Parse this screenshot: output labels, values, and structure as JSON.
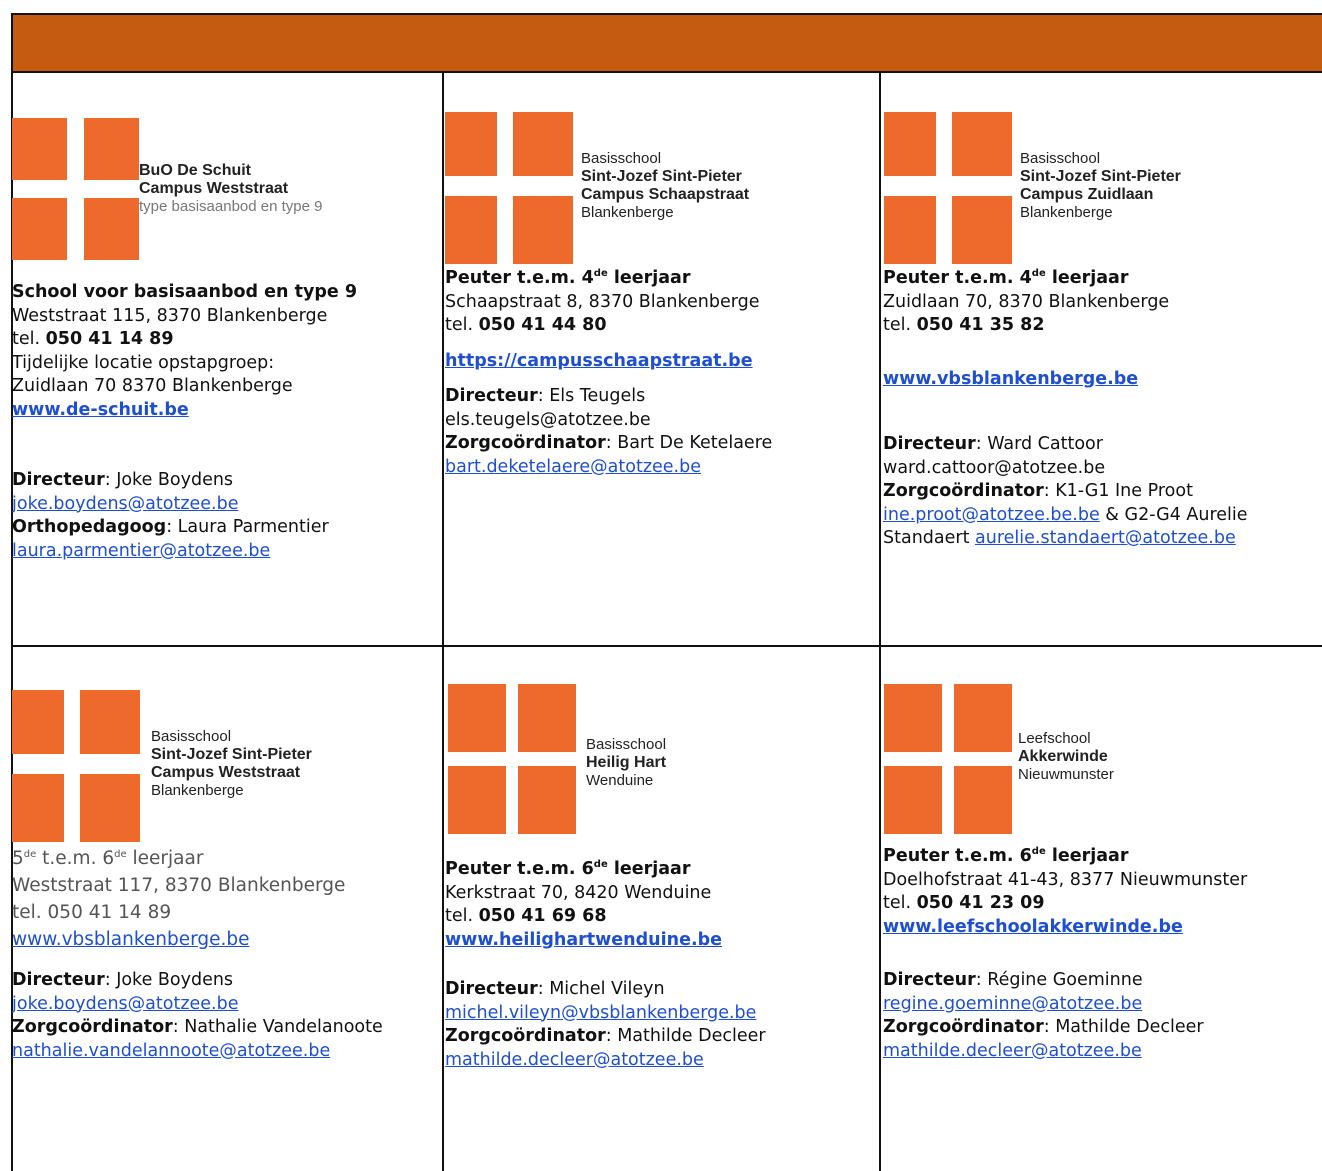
{
  "cells": [
    {
      "logo": {
        "lines": [
          "BuO De Schuit",
          "Campus Weststraat",
          "type basisaanbod en type 9"
        ]
      },
      "heading": "School voor basisaanbod en type 9",
      "address": "Weststraat 115, 8370 Blankenberge",
      "tel_prefix": "tel. ",
      "tel": "050 41 14 89",
      "extra1": "Tijdelijke locatie opstapgroep:",
      "extra2": "Zuidlaan 70 8370 Blankenberge",
      "website": "www.de-schuit.be",
      "role1": "Directeur",
      "person1": ": Joke Boydens",
      "email1": "joke.boydens@atotzee.be",
      "role2": "Orthopedagoog",
      "person2": ": Laura Parmentier",
      "email2": "laura.parmentier@atotzee.be"
    },
    {
      "logo": {
        "lines": [
          "Basisschool",
          "Sint-Jozef Sint-Pieter",
          "Campus Schaapstraat",
          "Blankenberge"
        ]
      },
      "heading_a": "Peuter t.e.m. 4",
      "heading_sup": "de",
      "heading_b": " leerjaar",
      "address": "Schaapstraat 8, 8370 Blankenberge",
      "tel_prefix": "tel. ",
      "tel": "050 41 44 80",
      "website": "https://campusschaapstraat.be",
      "role1": "Directeur",
      "person1": ": Els Teugels",
      "email1": "els.teugels@atotzee.be",
      "role2": "Zorgcoördinator",
      "person2": ": Bart De Ketelaere",
      "email2": "bart.deketelaere@atotzee.be"
    },
    {
      "logo": {
        "lines": [
          "Basisschool",
          "Sint-Jozef Sint-Pieter",
          "Campus Zuidlaan",
          "Blankenberge"
        ]
      },
      "heading_a": "Peuter t.e.m. 4",
      "heading_sup": "de",
      "heading_b": " leerjaar",
      "address": "Zuidlaan 70, 8370 Blankenberge",
      "tel_prefix": "tel. ",
      "tel": "050 41 35 82",
      "website": "www.vbsblankenberge.be",
      "role1": "Directeur",
      "person1": ": Ward Cattoor",
      "email1": "ward.cattoor@atotzee.be",
      "role2": "Zorgcoördinator",
      "person2": ": K1-G1 Ine Proot",
      "email2": "ine.proot@atotzee.be.be",
      "email2_suffix": " & G2-G4 Aurelie",
      "line_prefix": "Standaert ",
      "email3": "aurelie.standaert@atotzee.be"
    },
    {
      "logo": {
        "lines": [
          "Basisschool",
          "Sint-Jozef Sint-Pieter",
          "Campus Weststraat",
          "Blankenberge"
        ]
      },
      "grade_a": "5",
      "grade_sup1": "de",
      "grade_b": " t.e.m. 6",
      "grade_sup2": "de",
      "grade_c": " leerjaar",
      "address": "Weststraat 117, 8370 Blankenberge",
      "tel_line": "tel. 050 41 14 89",
      "website": "www.vbsblankenberge.be",
      "role1": "Directeur",
      "person1": ": Joke Boydens",
      "email1": "joke.boydens@atotzee.be",
      "role2": "Zorgcoördinator",
      "person2": ": Nathalie Vandelanoote",
      "email2": "nathalie.vandelannoote@atotzee.be"
    },
    {
      "logo": {
        "lines": [
          "Basisschool",
          "Heilig Hart",
          "Wenduine"
        ]
      },
      "heading_a": "Peuter t.e.m. 6",
      "heading_sup": "de",
      "heading_b": " leerjaar",
      "address": "Kerkstraat 70, 8420 Wenduine",
      "tel_prefix": "tel. ",
      "tel": "050 41 69 68",
      "website": "www.heilighartwenduine.be",
      "role1": "Directeur",
      "person1": ": Michel Vileyn",
      "email1": "michel.vileyn@vbsblankenberge.be",
      "role2": "Zorgcoördinator",
      "person2": ": Mathilde Decleer",
      "email2": "mathilde.decleer@atotzee.be"
    },
    {
      "logo": {
        "lines": [
          "Leefschool",
          "Akkerwinde",
          "Nieuwmunster"
        ]
      },
      "heading_a": "Peuter t.e.m. 6",
      "heading_sup": "de",
      "heading_b": " leerjaar",
      "address": "Doelhofstraat 41-43, 8377 Nieuwmunster",
      "tel_prefix": "tel. ",
      "tel": "050 41 23 09",
      "website": "www.leefschoolakkerwinde.be",
      "role1": "Directeur",
      "person1": ": Régine Goeminne",
      "email1": "regine.goeminne@atotzee.be",
      "role2": "Zorgcoördinator",
      "person2": ": Mathilde Decleer",
      "email2": "mathilde.decleer@atotzee.be"
    }
  ],
  "colors": {
    "header": "#C55A11",
    "logo": "#EE6A2C",
    "link": "#1F4FD1"
  }
}
